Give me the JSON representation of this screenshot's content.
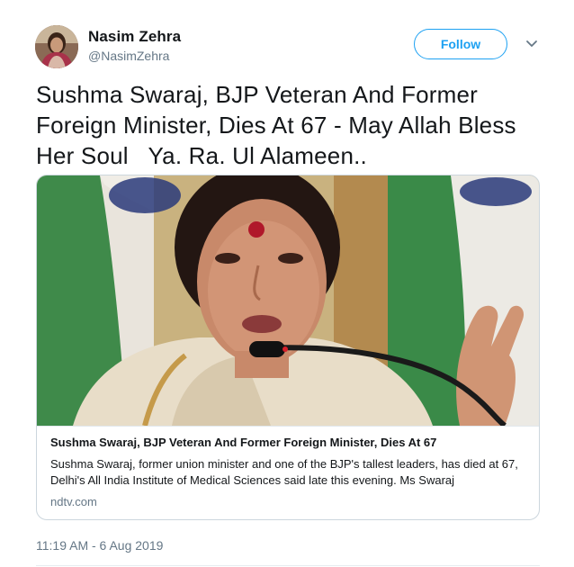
{
  "author": {
    "display_name": "Nasim Zehra",
    "handle": "@NasimZehra",
    "avatar_icon": "profile-photo"
  },
  "actions": {
    "follow_label": "Follow",
    "more_icon": "chevron-down-icon"
  },
  "tweet": {
    "text": "Sushma Swaraj, BJP Veteran And Former Foreign Minister, Dies At 67 - May Allah Bless Her Soul   Ya. Ra. Ul Alameen..",
    "timestamp": "11:19 AM - 6 Aug 2019"
  },
  "card": {
    "image_icon": "news-photo",
    "title": "Sushma Swaraj, BJP Veteran And Former Foreign Minister, Dies At 67",
    "description": "Sushma Swaraj, former union minister and one of the BJP's tallest leaders, has died at 67, Delhi's All India Institute of Medical Sciences said late this evening. Ms Swaraj",
    "domain": "ndtv.com"
  },
  "colors": {
    "accent": "#1da1f2",
    "text": "#14171a",
    "secondary_text": "#657786",
    "border": "#ccd6dd"
  }
}
